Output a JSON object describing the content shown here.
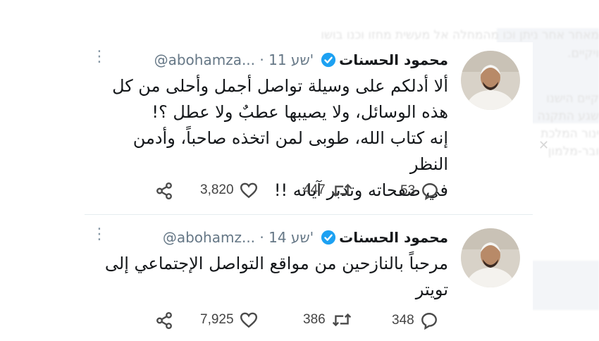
{
  "background": {
    "lines": [
      "מאחר אחר ניתן וכו מהמחלה אל מעשית מחזו וכנו בושו",
      "ויקיים.",
      "קיים הישנו",
      "שגע התקנה",
      "ינור המלכת",
      "ובר-מלמון"
    ]
  },
  "tweets": [
    {
      "name": "محمود الحسنات",
      "handle": "@abohamza...",
      "time": "11 שע'",
      "text": "ألا أدلكم على وسيلة تواصل أجمل وأحلى من كل\nهذه الوسائل، ولا يصيبها عطبٌ ولا عطل ؟!\nإنه كتاب الله، طوبى لمن اتخذه صاحباً، وأدمن النظر\nفي صفحاته وتدبر آياته !!",
      "replies": "53",
      "retweets": "447",
      "likes": "3,820"
    },
    {
      "name": "محمود الحسنات",
      "handle": "@abohamz...",
      "time": "14 שע'",
      "text": "مرحباً بالنازحين من مواقع التواصل الإجتماعي إلى\nتويتر",
      "replies": "348",
      "retweets": "386",
      "likes": "7,925"
    }
  ],
  "icons": [
    "verified-badge-icon",
    "more-icon",
    "reply-icon",
    "retweet-icon",
    "like-icon",
    "share-icon"
  ],
  "colors": {
    "verified": "#1da1f2",
    "name": "#14171a",
    "meta": "#657786",
    "icon": "#4a4a4a"
  }
}
